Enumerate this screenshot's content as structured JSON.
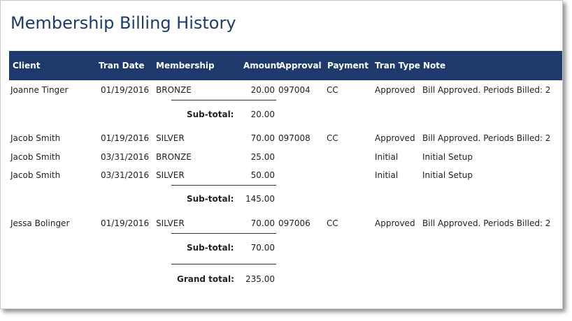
{
  "report": {
    "title": "Membership Billing History"
  },
  "columns": {
    "client": "Client",
    "tran_date": "Tran Date",
    "membership": "Membership",
    "amount": "Amount",
    "approval": "Approval",
    "payment": "Payment",
    "tran_type": "Tran Type",
    "note": "Note"
  },
  "groups": [
    {
      "rows": [
        {
          "client": "Joanne Tinger",
          "tran_date": "01/19/2016",
          "membership": "BRONZE",
          "amount": "20.00",
          "approval": "097004",
          "payment": "CC",
          "tran_type": "Approved",
          "note": "Bill Approved. Periods Billed: 2"
        }
      ],
      "subtotal_label": "Sub-total:",
      "subtotal": "20.00"
    },
    {
      "rows": [
        {
          "client": "Jacob Smith",
          "tran_date": "01/19/2016",
          "membership": "SILVER",
          "amount": "70.00",
          "approval": "097008",
          "payment": "CC",
          "tran_type": "Approved",
          "note": "Bill Approved. Periods Billed: 2"
        },
        {
          "client": "Jacob Smith",
          "tran_date": "03/31/2016",
          "membership": "BRONZE",
          "amount": "25.00",
          "approval": "",
          "payment": "",
          "tran_type": "Initial",
          "note": "Initial Setup"
        },
        {
          "client": "Jacob Smith",
          "tran_date": "03/31/2016",
          "membership": "SILVER",
          "amount": "50.00",
          "approval": "",
          "payment": "",
          "tran_type": "Initial",
          "note": "Initial Setup"
        }
      ],
      "subtotal_label": "Sub-total:",
      "subtotal": "145.00"
    },
    {
      "rows": [
        {
          "client": "Jessa Bolinger",
          "tran_date": "01/19/2016",
          "membership": "SILVER",
          "amount": "70.00",
          "approval": "097006",
          "payment": "CC",
          "tran_type": "Approved",
          "note": "Bill Approved. Periods Billed: 2"
        }
      ],
      "subtotal_label": "Sub-total:",
      "subtotal": "70.00"
    }
  ],
  "grand_total": {
    "label": "Grand total:",
    "value": "235.00"
  },
  "colors": {
    "title": "#1f3a6e",
    "header_bar": "#1e3a6d",
    "header_text": "#ffffff",
    "body_text": "#222222"
  }
}
